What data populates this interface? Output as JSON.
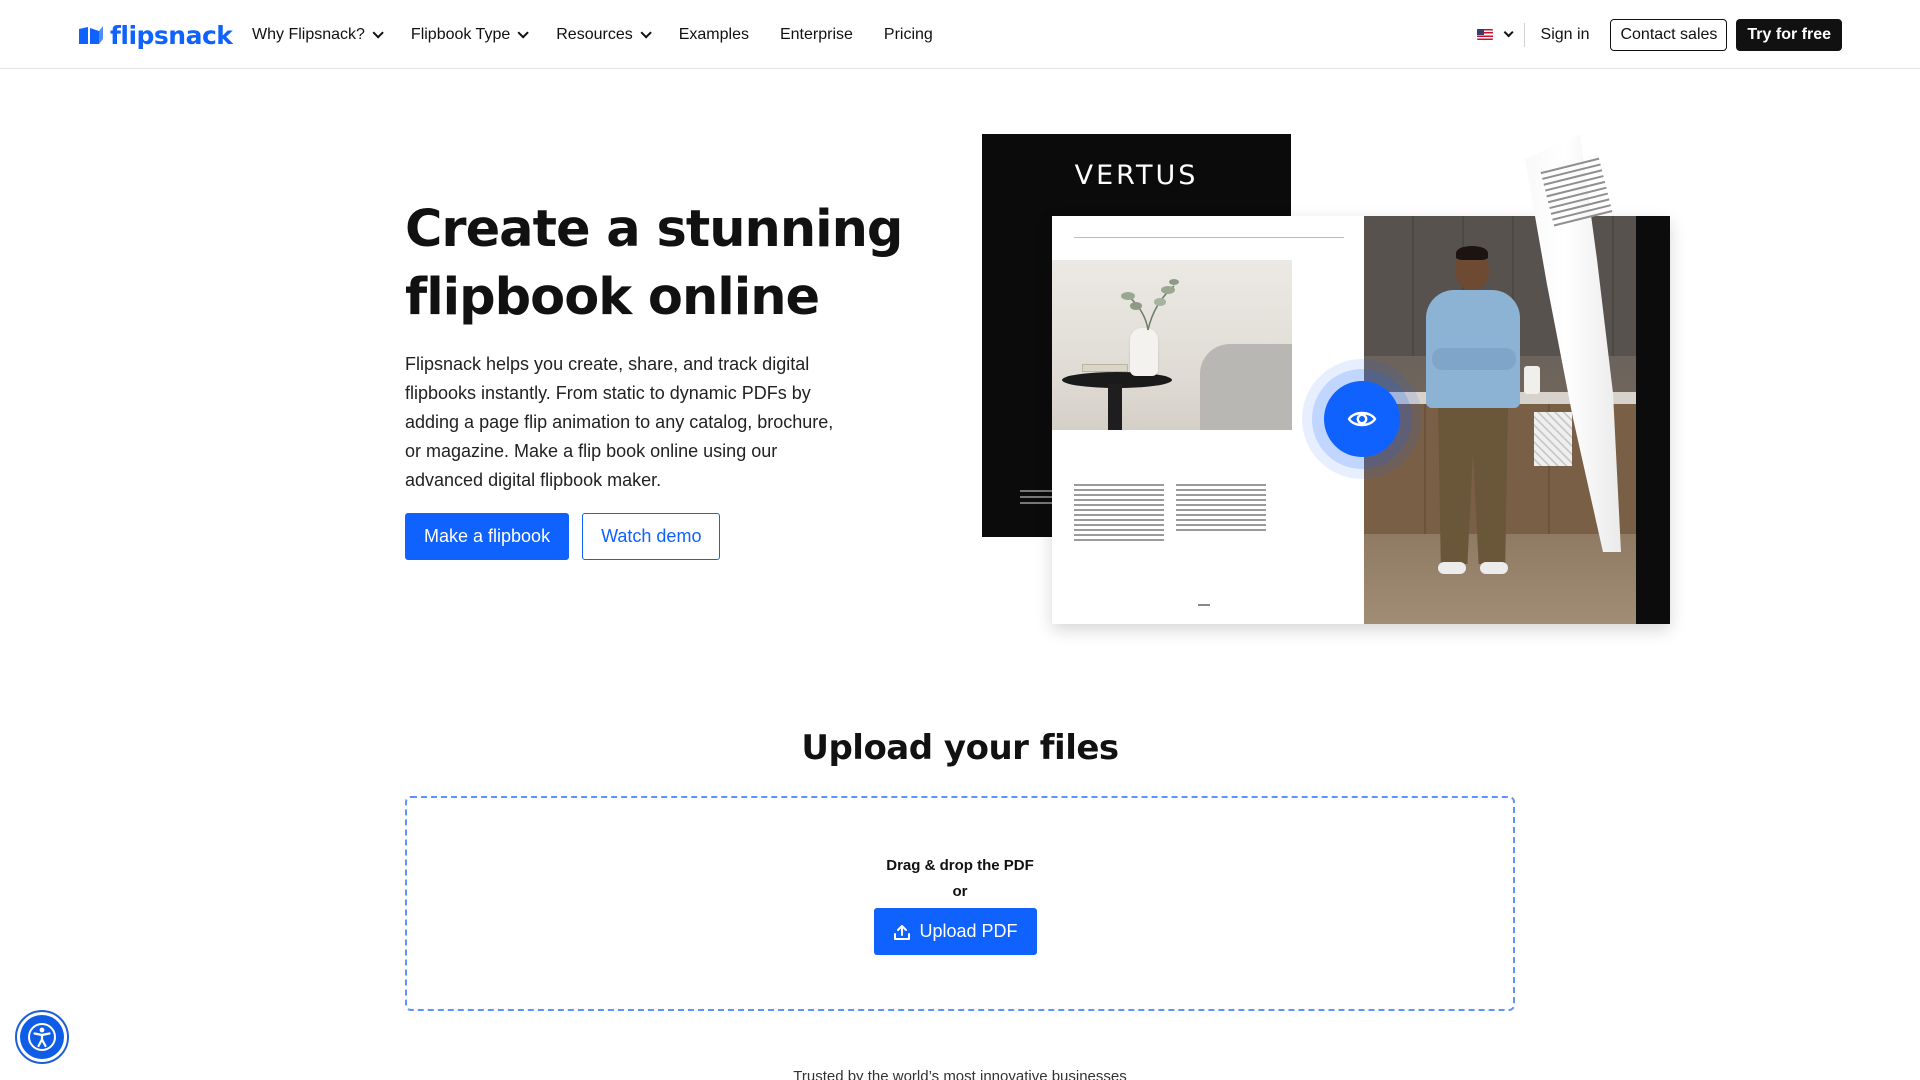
{
  "brand": {
    "name": "flipsnack",
    "color": "#0f62fe"
  },
  "nav": {
    "items": [
      {
        "label": "Why Flipsnack?",
        "has_dropdown": true
      },
      {
        "label": "Flipbook Type",
        "has_dropdown": true
      },
      {
        "label": "Resources",
        "has_dropdown": true
      },
      {
        "label": "Examples",
        "has_dropdown": false
      },
      {
        "label": "Enterprise",
        "has_dropdown": false
      },
      {
        "label": "Pricing",
        "has_dropdown": false
      }
    ],
    "language_icon": "us-flag-icon",
    "sign_in": "Sign in",
    "contact_sales": "Contact sales",
    "try_free": "Try for free"
  },
  "hero": {
    "title": "Create a stunning flipbook online",
    "description": "Flipsnack helps you create, share, and track digital flipbooks instantly. From static to dynamic PDFs by adding a page flip animation to any catalog, brochure, or magazine. Make a flip book online using our advanced digital flipbook maker.",
    "primary_button": "Make a flipbook",
    "secondary_button": "Watch demo",
    "visual": {
      "back_magazine_title": "VERTUS",
      "view_icon": "eye-icon"
    }
  },
  "upload": {
    "title": "Upload your files",
    "drag_text": "Drag & drop the PDF",
    "or_text": "or",
    "button": "Upload PDF",
    "button_icon": "upload-icon",
    "border_color": "#5c93ff"
  },
  "trusted_text": "Trusted by the world’s most innovative businesses",
  "accessibility": {
    "icon": "accessibility-icon"
  }
}
